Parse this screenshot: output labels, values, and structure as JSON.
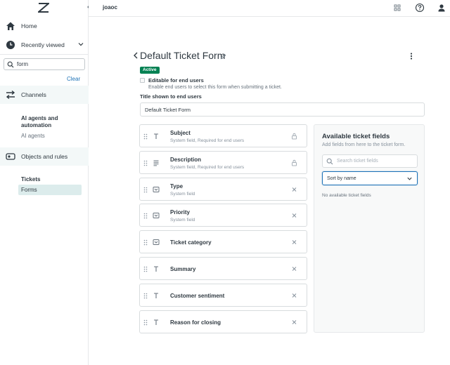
{
  "header": {
    "org_name": "joaoc",
    "icons": [
      "apps-grid-icon",
      "help-icon",
      "user-icon"
    ]
  },
  "nav": {
    "logo": "zendesk-logo",
    "home_label": "Home",
    "recently_viewed_label": "Recently viewed",
    "search_value": "form",
    "clear_label": "Clear",
    "channels_label": "Channels",
    "ai_heading": "AI agents and automation",
    "ai_item": "AI agents",
    "objects_label": "Objects and rules",
    "tickets_heading": "Tickets",
    "forms_item": "Forms"
  },
  "form": {
    "title": "Default Ticket Form",
    "status_badge": "Active",
    "editable_label": "Editable for end users",
    "editable_hint": "Enable end users to select this form when submitting a ticket.",
    "title_label": "Title shown to end users",
    "title_value": "Default Ticket Form"
  },
  "fields": [
    {
      "name": "Subject",
      "desc": "System field, Required for end users",
      "icon": "text-icon",
      "action": "lock-icon"
    },
    {
      "name": "Description",
      "desc": "System field, Required for end users",
      "icon": "multiline-text-icon",
      "action": "lock-icon"
    },
    {
      "name": "Type",
      "desc": "System field",
      "icon": "dropdown-icon",
      "action": "remove-icon"
    },
    {
      "name": "Priority",
      "desc": "System field",
      "icon": "dropdown-icon",
      "action": "remove-icon"
    },
    {
      "name": "Ticket category",
      "desc": "",
      "icon": "dropdown-icon",
      "action": "remove-icon"
    },
    {
      "name": "Summary",
      "desc": "",
      "icon": "text-icon",
      "action": "remove-icon"
    },
    {
      "name": "Customer sentiment",
      "desc": "",
      "icon": "text-icon",
      "action": "remove-icon"
    },
    {
      "name": "Reason for closing",
      "desc": "",
      "icon": "text-icon",
      "action": "remove-icon"
    }
  ],
  "available": {
    "title": "Available ticket fields",
    "hint": "Add fields from here to the ticket form.",
    "search_placeholder": "Search ticket fields",
    "sort_value": "Sort by name",
    "empty_text": "No available ticket fields"
  },
  "colors": {
    "accent": "#1f73b7",
    "active_badge": "#038153",
    "nav_highlight": "#dcecec"
  }
}
